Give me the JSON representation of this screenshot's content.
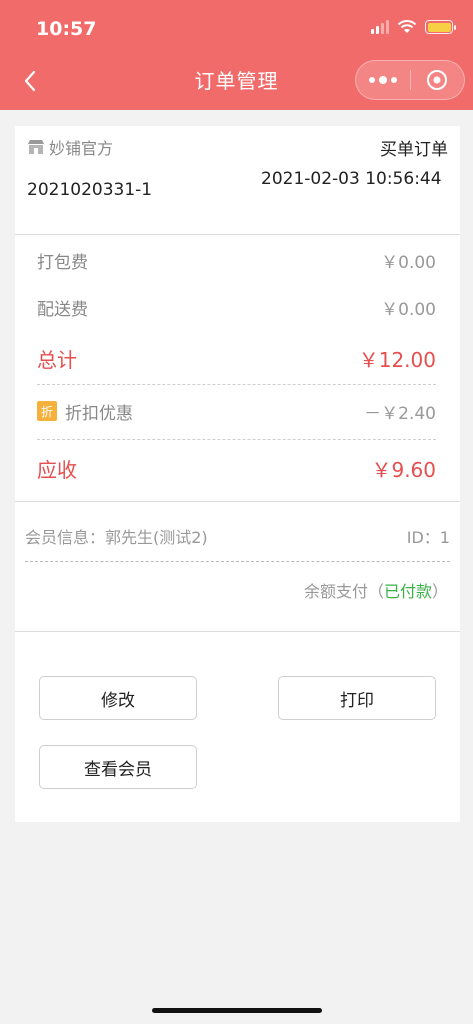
{
  "status_bar": {
    "time": "10:57"
  },
  "nav": {
    "title": "订单管理"
  },
  "order": {
    "shop_name": "妙铺官方",
    "type": "买单订单",
    "number": "2021020331-1",
    "time": "2021-02-03 10:56:44"
  },
  "fees": {
    "packing": {
      "label": "打包费",
      "value": "￥0.00"
    },
    "delivery": {
      "label": "配送费",
      "value": "￥0.00"
    },
    "total": {
      "label": "总计",
      "value": "￥12.00"
    },
    "discount": {
      "tag": "折",
      "label": "折扣优惠",
      "value": "－￥2.40"
    },
    "receivable": {
      "label": "应收",
      "value": "￥9.60"
    }
  },
  "member": {
    "info": "会员信息：郭先生(测试2)",
    "id": "ID：1"
  },
  "payment": {
    "method": "余额支付（",
    "status": "已付款",
    "close": "）"
  },
  "buttons": {
    "modify": "修改",
    "print": "打印",
    "view_member": "查看会员"
  },
  "colors": {
    "brand": "#f26b6b",
    "price_red": "#e64f4f",
    "paid_green": "#3bb14a",
    "discount_tag": "#f5b13c"
  }
}
